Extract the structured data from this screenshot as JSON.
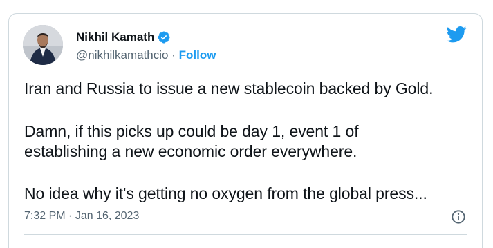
{
  "author": {
    "name": "Nikhil Kamath",
    "handle": "@nikhilkamathcio",
    "separator": "·",
    "follow_label": "Follow"
  },
  "tweet": {
    "line1": "Iran and Russia to issue a new stablecoin backed by Gold.",
    "line2": "Damn, if this picks up could be day 1, event 1 of",
    "line3": "establishing a new economic order everywhere.",
    "line4": "No idea why it's getting no oxygen from the global press..."
  },
  "meta": {
    "time": "7:32 PM",
    "dot": "·",
    "date": "Jan 16, 2023"
  },
  "icons": {
    "verified": "verified-badge-icon",
    "platform": "twitter-bird-icon",
    "info": "info-icon"
  },
  "colors": {
    "accent": "#1d9bf0",
    "text": "#0f1419",
    "muted": "#536471",
    "border": "#cfd9de"
  }
}
